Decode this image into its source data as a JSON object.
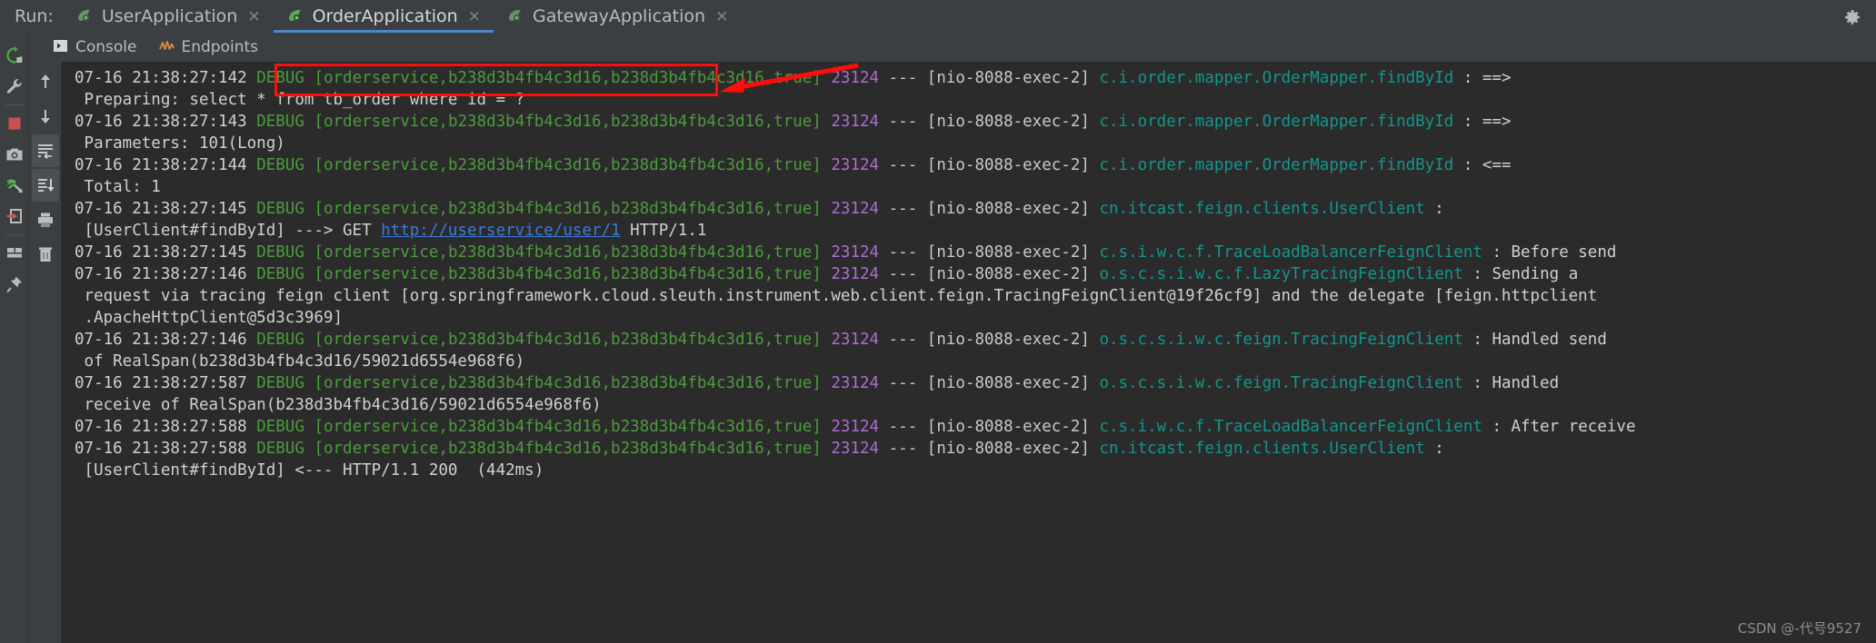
{
  "window": {
    "run_label": "Run:",
    "gear_icon": "gear-icon"
  },
  "run_tabs": [
    {
      "label": "UserApplication",
      "icon": "spring-boot-icon",
      "close": "×",
      "active": false
    },
    {
      "label": "OrderApplication",
      "icon": "spring-boot-icon",
      "close": "×",
      "active": true
    },
    {
      "label": "GatewayApplication",
      "icon": "spring-boot-icon",
      "close": "×",
      "active": false
    }
  ],
  "console_tabs": [
    {
      "label": "Console",
      "icon": "console-icon"
    },
    {
      "label": "Endpoints",
      "icon": "endpoints-icon"
    }
  ],
  "left_toolbar": [
    {
      "name": "rerun-icon",
      "title": "Rerun"
    },
    {
      "name": "wrench-icon",
      "title": "Edit Configuration"
    },
    {
      "name": "separator",
      "title": ""
    },
    {
      "name": "stop-icon",
      "title": "Stop"
    },
    {
      "name": "camera-icon",
      "title": "Snapshot"
    },
    {
      "name": "dump-threads-icon",
      "title": "Dump Threads"
    },
    {
      "name": "exit-icon",
      "title": "Exit"
    },
    {
      "name": "separator",
      "title": ""
    },
    {
      "name": "layout-icon",
      "title": "Layout Settings"
    },
    {
      "name": "pin-icon",
      "title": "Pin Tab"
    }
  ],
  "console_toolbar": [
    {
      "name": "arrow-up-icon",
      "title": "Up the stack trace"
    },
    {
      "name": "arrow-down-icon",
      "title": "Down the stack trace"
    },
    {
      "name": "soft-wrap-icon",
      "title": "Use Soft Wraps"
    },
    {
      "name": "scroll-to-end-icon",
      "title": "Scroll to the end"
    },
    {
      "name": "print-icon",
      "title": "Print"
    },
    {
      "name": "trash-icon",
      "title": "Clear All"
    }
  ],
  "annotation": {
    "redbox_label": "highlight-rectangle",
    "arrow_label": "red-arrow"
  },
  "watermark": "CSDN @-代号9527",
  "colors": {
    "accent": "#4a88c7",
    "console_bg": "#2b2b2b",
    "chrome_bg": "#3c3f41",
    "level": "#4e9a3f",
    "pid": "#b06bd4",
    "logger": "#12968e",
    "link": "#3a7bd5",
    "annotation": "#ff0d0d"
  },
  "log_lines": [
    {
      "type": "entry",
      "time": "07-16 21:38:27:142",
      "level": "DEBUG",
      "trace": "[orderservice,b238d3b4fb4c3d16,b238d3b4fb4c3d16,true]",
      "pid": "23124",
      "dashes": "---",
      "thread": "[nio-8088-exec-2]",
      "logger": "c.i.order.mapper.OrderMapper.findById",
      "sep": ":",
      "message": "==>"
    },
    {
      "type": "cont",
      "text": " Preparing: select * from tb_order where id = ?"
    },
    {
      "type": "entry",
      "time": "07-16 21:38:27:143",
      "level": "DEBUG",
      "trace": "[orderservice,b238d3b4fb4c3d16,b238d3b4fb4c3d16,true]",
      "pid": "23124",
      "dashes": "---",
      "thread": "[nio-8088-exec-2]",
      "logger": "c.i.order.mapper.OrderMapper.findById",
      "sep": ":",
      "message": "==>"
    },
    {
      "type": "cont",
      "text": " Parameters: 101(Long)"
    },
    {
      "type": "entry",
      "time": "07-16 21:38:27:144",
      "level": "DEBUG",
      "trace": "[orderservice,b238d3b4fb4c3d16,b238d3b4fb4c3d16,true]",
      "pid": "23124",
      "dashes": "---",
      "thread": "[nio-8088-exec-2]",
      "logger": "c.i.order.mapper.OrderMapper.findById",
      "sep": ":",
      "message": "<=="
    },
    {
      "type": "cont",
      "text": " Total: 1"
    },
    {
      "type": "entry",
      "time": "07-16 21:38:27:145",
      "level": "DEBUG",
      "trace": "[orderservice,b238d3b4fb4c3d16,b238d3b4fb4c3d16,true]",
      "pid": "23124",
      "dashes": "---",
      "thread": "[nio-8088-exec-2]",
      "logger": "cn.itcast.feign.clients.UserClient",
      "sep": ":",
      "message": ""
    },
    {
      "type": "link",
      "pre": " [UserClient#findById] ---> GET ",
      "link": "http://userservice/user/1",
      "post": " HTTP/1.1"
    },
    {
      "type": "entry",
      "time": "07-16 21:38:27:145",
      "level": "DEBUG",
      "trace": "[orderservice,b238d3b4fb4c3d16,b238d3b4fb4c3d16,true]",
      "pid": "23124",
      "dashes": "---",
      "thread": "[nio-8088-exec-2]",
      "logger": "c.s.i.w.c.f.TraceLoadBalancerFeignClient",
      "sep": ":",
      "message": "Before send"
    },
    {
      "type": "entry",
      "time": "07-16 21:38:27:146",
      "level": "DEBUG",
      "trace": "[orderservice,b238d3b4fb4c3d16,b238d3b4fb4c3d16,true]",
      "pid": "23124",
      "dashes": "---",
      "thread": "[nio-8088-exec-2]",
      "logger": "o.s.c.s.i.w.c.f.LazyTracingFeignClient",
      "sep": ":",
      "message": "Sending a"
    },
    {
      "type": "cont",
      "text": " request via tracing feign client [org.springframework.cloud.sleuth.instrument.web.client.feign.TracingFeignClient@19f26cf9] and the delegate [feign.httpclient"
    },
    {
      "type": "cont",
      "text": " .ApacheHttpClient@5d3c3969]"
    },
    {
      "type": "entry",
      "time": "07-16 21:38:27:146",
      "level": "DEBUG",
      "trace": "[orderservice,b238d3b4fb4c3d16,b238d3b4fb4c3d16,true]",
      "pid": "23124",
      "dashes": "---",
      "thread": "[nio-8088-exec-2]",
      "logger": "o.s.c.s.i.w.c.feign.TracingFeignClient",
      "sep": ":",
      "message": "Handled send"
    },
    {
      "type": "cont",
      "text": " of RealSpan(b238d3b4fb4c3d16/59021d6554e968f6)"
    },
    {
      "type": "entry",
      "time": "07-16 21:38:27:587",
      "level": "DEBUG",
      "trace": "[orderservice,b238d3b4fb4c3d16,b238d3b4fb4c3d16,true]",
      "pid": "23124",
      "dashes": "---",
      "thread": "[nio-8088-exec-2]",
      "logger": "o.s.c.s.i.w.c.feign.TracingFeignClient",
      "sep": ":",
      "message": "Handled"
    },
    {
      "type": "cont",
      "text": " receive of RealSpan(b238d3b4fb4c3d16/59021d6554e968f6)"
    },
    {
      "type": "entry",
      "time": "07-16 21:38:27:588",
      "level": "DEBUG",
      "trace": "[orderservice,b238d3b4fb4c3d16,b238d3b4fb4c3d16,true]",
      "pid": "23124",
      "dashes": "---",
      "thread": "[nio-8088-exec-2]",
      "logger": "c.s.i.w.c.f.TraceLoadBalancerFeignClient",
      "sep": ":",
      "message": "After receive"
    },
    {
      "type": "entry",
      "time": "07-16 21:38:27:588",
      "level": "DEBUG",
      "trace": "[orderservice,b238d3b4fb4c3d16,b238d3b4fb4c3d16,true]",
      "pid": "23124",
      "dashes": "---",
      "thread": "[nio-8088-exec-2]",
      "logger": "cn.itcast.feign.clients.UserClient",
      "sep": ":",
      "message": ""
    },
    {
      "type": "cont",
      "text": " [UserClient#findById] <--- HTTP/1.1 200  (442ms)"
    }
  ]
}
